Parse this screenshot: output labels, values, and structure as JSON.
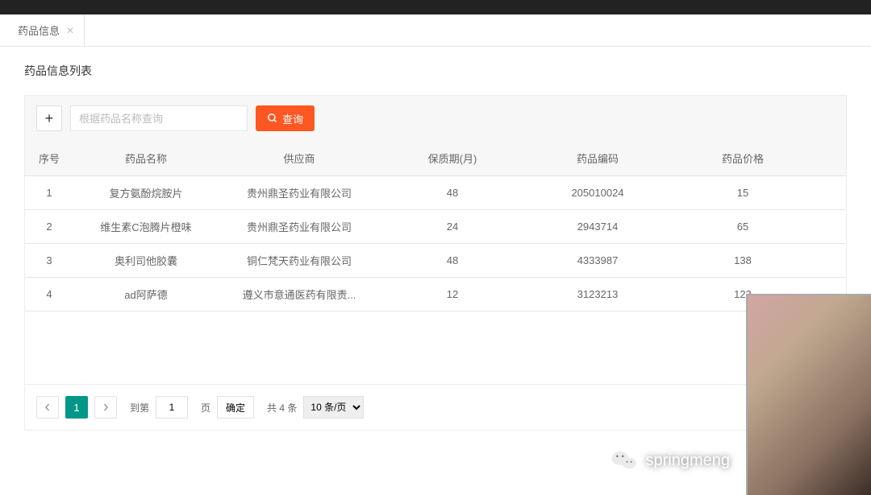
{
  "tab": {
    "label": "药品信息"
  },
  "page": {
    "title": "药品信息列表"
  },
  "toolbar": {
    "add_label": "+",
    "search_placeholder": "根据药品名称查询",
    "search_button": "查询"
  },
  "table": {
    "headers": {
      "seq": "序号",
      "name": "药品名称",
      "supplier": "供应商",
      "shelf": "保质期(月)",
      "code": "药品编码",
      "price": "药品价格"
    },
    "rows": [
      {
        "seq": "1",
        "name": "复方氨酚烷胺片",
        "supplier": "贵州鼎圣药业有限公司",
        "shelf": "48",
        "code": "205010024",
        "price": "15"
      },
      {
        "seq": "2",
        "name": "维生素C泡腾片橙味",
        "supplier": "贵州鼎圣药业有限公司",
        "shelf": "24",
        "code": "2943714",
        "price": "65"
      },
      {
        "seq": "3",
        "name": "奥利司他胶囊",
        "supplier": "铜仁梵天药业有限公司",
        "shelf": "48",
        "code": "4333987",
        "price": "138"
      },
      {
        "seq": "4",
        "name": "ad阿萨德",
        "supplier": "遵义市意通医药有限责...",
        "shelf": "12",
        "code": "3123213",
        "price": "123"
      }
    ]
  },
  "pagination": {
    "current_page": "1",
    "goto_label": "到第",
    "page_input": "1",
    "page_suffix": "页",
    "confirm": "确定",
    "total": "共 4 条",
    "per_page": "10 条/页"
  },
  "overlay": {
    "username": "springmeng"
  }
}
